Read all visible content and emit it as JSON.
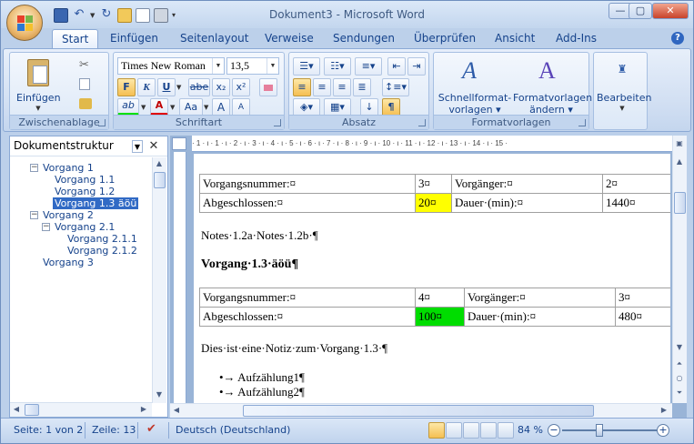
{
  "window": {
    "title": "Dokument3 - Microsoft Word",
    "controls": {
      "minimize": "—",
      "maximize": "▢",
      "close": "✕"
    }
  },
  "tabs": [
    "Start",
    "Einfügen",
    "Seitenlayout",
    "Verweise",
    "Sendungen",
    "Überprüfen",
    "Ansicht",
    "Add-Ins"
  ],
  "ribbon": {
    "clipboard": {
      "label": "Zwischenablage",
      "paste": "Einfügen"
    },
    "font": {
      "label": "Schriftart",
      "font_name": "Times New Roman",
      "font_size": "13,5",
      "bold": "F",
      "italic": "K",
      "underline": "U",
      "strike": "abe",
      "sub": "x₂",
      "sup": "x²",
      "highlight": "ab",
      "color": "A",
      "case": "Aa",
      "grow": "A",
      "shrink": "A"
    },
    "paragraph": {
      "label": "Absatz",
      "pilcrow": "¶"
    },
    "styles": {
      "label": "Formatvorlagen",
      "quick_1": "Schnellformat-",
      "quick_2": "vorlagen",
      "change_1": "Formatvorlagen",
      "change_2": "ändern"
    },
    "edit": {
      "label": "Bearbeiten"
    }
  },
  "navpane": {
    "title": "Dokumentstruktur",
    "items": [
      {
        "label": "Vorgang 1",
        "expander": "−"
      },
      {
        "label": "Vorgang 1.1"
      },
      {
        "label": "Vorgang 1.2"
      },
      {
        "label": "Vorgang 1.3 äöü"
      },
      {
        "label": "Vorgang 2",
        "expander": "−"
      },
      {
        "label": "Vorgang 2.1",
        "expander": "−"
      },
      {
        "label": "Vorgang 2.1.1"
      },
      {
        "label": "Vorgang 2.1.2"
      },
      {
        "label": "Vorgang 3"
      }
    ]
  },
  "document": {
    "ruler": "· 1 · ι · 1 · ι · 2 · ι · 3 · ι · 4 · ι · 5 · ι · 6 · ι · 7 · ι · 8 · ι · 9 · ι · 10 · ι · 11 · ι · 12 · ι · 13 · ι · 14 · ι · 15 ·",
    "table1": {
      "row1": [
        "Vorgangsnummer:¤",
        "3¤",
        "Vorgänger:¤",
        "2¤"
      ],
      "row2": [
        "Abgeschlossen:¤",
        "20¤",
        "Dauer·(min):¤",
        "1440¤"
      ],
      "highlight": "#ffff00"
    },
    "notes": "Notes·1.2a·Notes·1.2b·¶",
    "heading": "Vorgang·1.3·äöü¶",
    "table2": {
      "row1": [
        "Vorgangsnummer:¤",
        "4¤",
        "Vorgänger:¤",
        "3¤"
      ],
      "row2": [
        "Abgeschlossen:¤",
        "100¤",
        "Dauer·(min):¤",
        "480¤"
      ],
      "highlight": "#00dd00"
    },
    "note2": "Dies·ist·eine·Notiz·zum·Vorgang·1.3·¶",
    "bullets": [
      "•→ Aufzählung1¶",
      "•→ Aufzählung2¶"
    ]
  },
  "status": {
    "page": "Seite: 1 von 2",
    "line": "Zeile: 13",
    "language": "Deutsch (Deutschland)",
    "zoom": "84 %",
    "zoom_minus": "−",
    "zoom_plus": "+"
  }
}
